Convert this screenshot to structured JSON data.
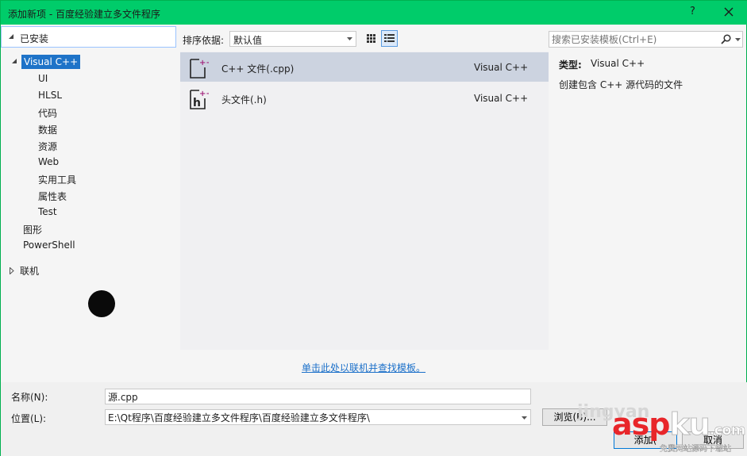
{
  "window": {
    "title": "添加新项 - 百度经验建立多文件程序",
    "help_label": "?",
    "close_icon": "close-icon"
  },
  "tree": {
    "installed_label": "已安装",
    "items": [
      {
        "label": "Visual C++",
        "selected": true
      },
      {
        "label": "UI"
      },
      {
        "label": "HLSL"
      },
      {
        "label": "代码"
      },
      {
        "label": "数据"
      },
      {
        "label": "资源"
      },
      {
        "label": "Web"
      },
      {
        "label": "实用工具"
      },
      {
        "label": "属性表"
      },
      {
        "label": "Test"
      },
      {
        "label": "图形"
      },
      {
        "label": "PowerShell"
      },
      {
        "label": "联机"
      }
    ]
  },
  "toolbar": {
    "sort_label": "排序依据:",
    "sort_value": "默认值"
  },
  "templates": [
    {
      "name": "C++ 文件(.cpp)",
      "language": "Visual C++",
      "selected": true,
      "icon": "cpp-file-icon"
    },
    {
      "name": "头文件(.h)",
      "language": "Visual C++",
      "selected": false,
      "icon": "header-file-icon"
    }
  ],
  "search": {
    "placeholder": "搜索已安装模板(Ctrl+E)"
  },
  "details": {
    "type_key": "类型:",
    "type_value": "Visual C++",
    "description": "创建包含 C++ 源代码的文件"
  },
  "online_link": "单击此处以联机并查找模板。",
  "form": {
    "name_label": "名称(N):",
    "name_value": "源.cpp",
    "location_label": "位置(L):",
    "location_value": "E:\\Qt程序\\百度经验建立多文件程序\\百度经验建立多文件程序\\",
    "browse_label": "浏览(B)...",
    "add_label": "添加(",
    "cancel_label": "取消"
  },
  "watermark": {
    "brand": "asp",
    "brand_ku": "ku",
    "brand_com": ".com",
    "sub": "免费网站源码下载站",
    "jingyan": "jingyan"
  },
  "colors": {
    "titlebar": "#00cc6a",
    "selection": "#1e73c8",
    "link": "#1a6fc9",
    "watermark_red": "#e8262a"
  }
}
